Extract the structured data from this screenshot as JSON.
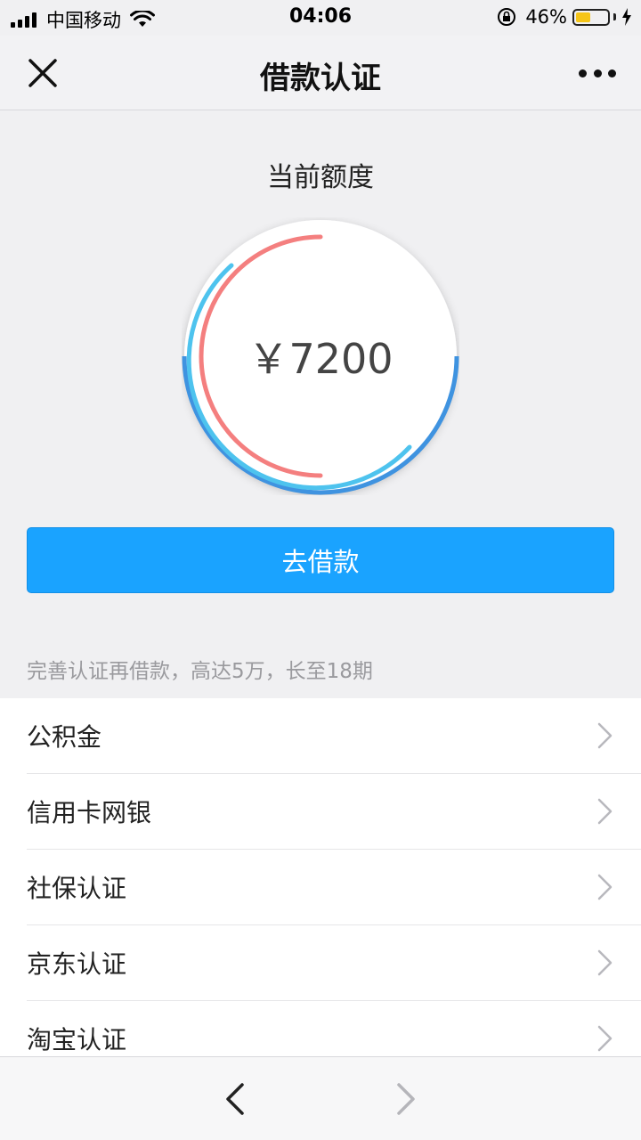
{
  "status_bar": {
    "carrier": "中国移动",
    "time": "04:06",
    "battery_percent_label": "46%",
    "battery_level": 0.46,
    "icons": [
      "signal-icon",
      "wifi-icon",
      "orientation-lock-icon",
      "battery-icon",
      "charging-bolt-icon"
    ]
  },
  "navbar": {
    "title": "借款认证",
    "close_icon": "close-icon",
    "more_icon": "more-dots-icon"
  },
  "credit": {
    "label": "当前额度",
    "amount": "￥7200"
  },
  "loan_button": {
    "label": "去借款"
  },
  "hint": "完善认证再借款，高达5万，长至18期",
  "verify_list": [
    {
      "label": "公积金"
    },
    {
      "label": "信用卡网银"
    },
    {
      "label": "社保认证"
    },
    {
      "label": "京东认证"
    },
    {
      "label": "淘宝认证"
    }
  ],
  "colors": {
    "primary_button": "#1aa3ff",
    "gauge_outer": "#3f93e0",
    "gauge_cyan": "#4ec3ee",
    "gauge_red": "#f47f7f"
  }
}
